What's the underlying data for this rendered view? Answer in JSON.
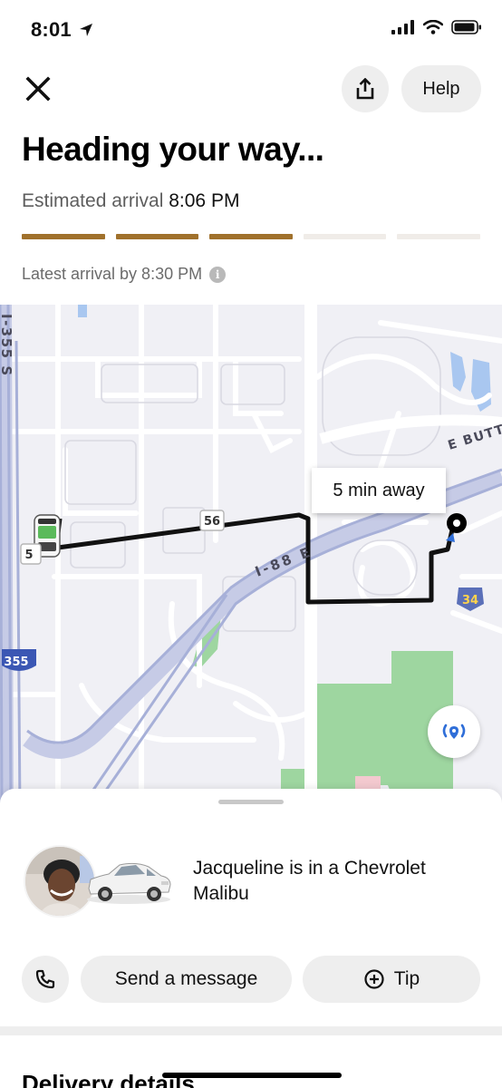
{
  "status_bar": {
    "time": "8:01"
  },
  "header": {
    "help_label": "Help",
    "title": "Heading your way...",
    "eta_label": "Estimated arrival",
    "eta_time": "8:06 PM",
    "progress_completed_segments": 3,
    "progress_total_segments": 5,
    "latest_arrival": "Latest arrival by 8:30 PM"
  },
  "map": {
    "eta_bubble": "5 min away",
    "labels": {
      "i355_vertical": "I-355 S",
      "e_butterfield": "E BUTT",
      "i88": "I-88 E",
      "shield_56": "56",
      "shield_5": "5",
      "shield_34": "34",
      "shield_355": "355"
    }
  },
  "driver": {
    "text": "Jacqueline is in a Chevrolet Malibu"
  },
  "actions": {
    "message_label": "Send a message",
    "tip_label": "Tip"
  },
  "section": {
    "delivery_details": "Delivery details"
  },
  "colors": {
    "progress_active": "#a0712c",
    "progress_inactive": "#f0ece8",
    "route": "#111111",
    "highway": "#a7b0d8",
    "park": "#9ed6a0",
    "water": "#a9c7f0"
  }
}
